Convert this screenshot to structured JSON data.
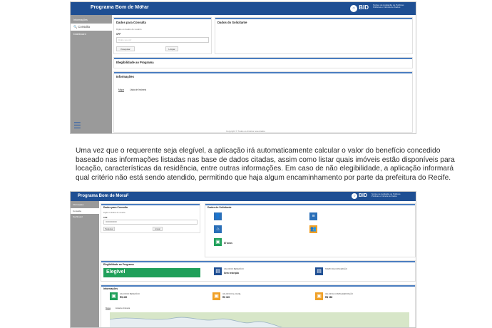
{
  "paragraph": {
    "lines": [
      "Uma vez que o requerente seja elegível, a aplicação irá automaticamente calcular o valor do benefício concedido",
      "baseado nas informações listadas nas base de dados citadas, assim como listar quais imóveis estão disponíveis para",
      "locação, características da residência, entre outras informações. Em caso de não elegibilidade, a aplicação informará",
      "qual critério não está sendo atendido, permitindo que haja algum encaminhamento por parte da prefeitura do Recife."
    ]
  },
  "screen1": {
    "app_title": "Programa Bom de Morar",
    "bid_logo": "BID",
    "bid_sub_1": "Núcleo de Avaliação de Políticas",
    "bid_sub_2": "Públicas e Ciência de Dados",
    "sidebar": {
      "items": [
        "Informações",
        "Consulta",
        "Dashboard"
      ]
    },
    "dados_consulta": {
      "title": "Dados para Consulta",
      "hint": "Digite os dados do usuário",
      "cpf_label": "CPF",
      "cpf_placeholder": "Digite seu cpf",
      "btn_pesquisar": "Pesquisar",
      "btn_limpar": "Limpar"
    },
    "dados_solicitante_title": "Dados do Solicitante",
    "elegibilidade_title": "Elegibilidade ao Programa",
    "informacoes_title": "Informações",
    "tabs": [
      "Mapa",
      "Lista de Imóveis"
    ],
    "footer": "Copyright © Todos os direitos reservados"
  },
  "screen2": {
    "app_title": "Programa Bom de Morar",
    "bid_logo": "BID",
    "bid_sub_1": "Núcleo de Avaliação de Políticas",
    "bid_sub_2": "Públicas e Ciência de Dados",
    "sidebar": {
      "items": [
        "Informações",
        "Consulta",
        "Dashboard"
      ]
    },
    "dados_consulta": {
      "title": "Dados para Consulta",
      "hint": "Digite os dados do usuário",
      "cpf_label": "CPF",
      "cpf_value": "00000000000",
      "btn_pesquisar": "Pesquisar",
      "btn_limpar": "Limpar"
    },
    "dados_solicitante_title": "Dados do Solicitante",
    "elegibilidade_title": "Elegibilidade ao Programa",
    "eleg_status": "Elegível",
    "eleg_tiles": [
      {
        "label": "VALOR DO BENEFÍCIO",
        "value": "Sem restrição"
      },
      {
        "label": "TEMPO DE CONCESSÃO",
        "value": ""
      }
    ],
    "informacoes_title": "Informações",
    "info_tiles": [
      {
        "label": "VALOR DO BENEFÍCIO",
        "value": "R$ 400"
      },
      {
        "label": "VALOR DO ALUGUEL",
        "value": "R$ 320"
      },
      {
        "label": "VALOR DA COMPLEMENTAÇÃO",
        "value": "R$ 080"
      }
    ],
    "tabs": [
      "Mapa",
      "Lista de Imóveis"
    ],
    "solicitante_values": [
      "87 anos"
    ]
  },
  "colors": {
    "topbar": "#1f4f93",
    "sidebar": "#9a9a9a",
    "accent": "#4a7dc0",
    "green": "#1fa05a",
    "orange": "#f0a026",
    "blue_tile": "#2a6fb8",
    "navy_tile": "#1f4f93"
  }
}
